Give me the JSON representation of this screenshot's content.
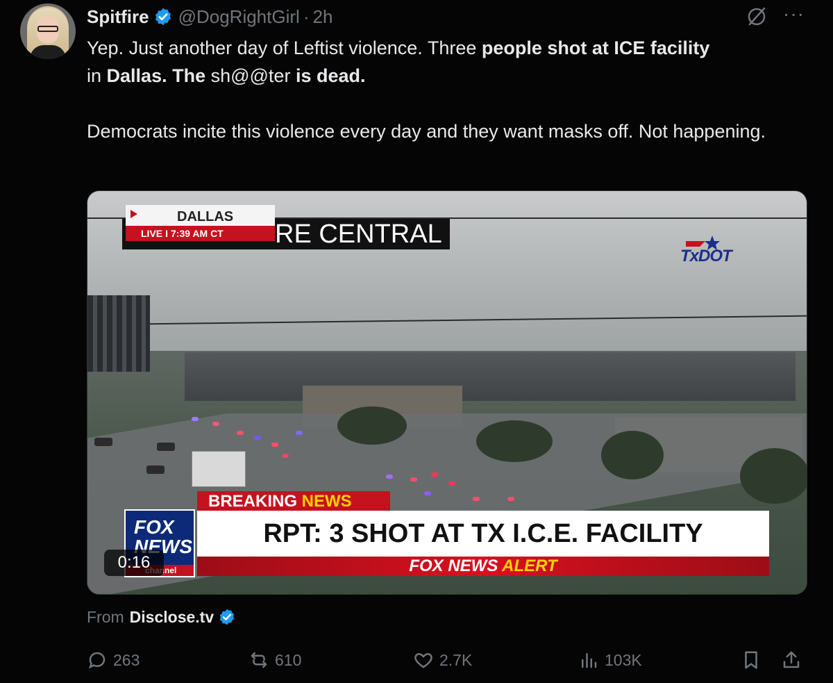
{
  "tweet": {
    "author_name": "Spitfire",
    "handle": "@DogRightGirl",
    "separator": "·",
    "time": "2h",
    "text_line1_a": "Yep. Just another day of Leftist violence. Three ",
    "text_line1_b": "people shot at ICE facility",
    "text_line2_a": "in ",
    "text_line2_b": "Dallas. The",
    "text_line2_c": " sh@@ter ",
    "text_line2_d": "is dead.",
    "text_para2": "Democrats incite this violence every day and they want masks off. Not happening."
  },
  "video": {
    "location": "DALLAS",
    "live_label": "LIVE",
    "live_sep": "I",
    "live_time": "7:39 AM CT",
    "cam_banner": "RE CENTRAL",
    "txdot_logo": "TxDOT",
    "breaking_a": "BREAKING ",
    "breaking_b": "NEWS",
    "headline": "RPT: 3 SHOT AT TX I.C.E. FACILITY",
    "alert_a": "FOX NEWS ",
    "alert_b": "ALERT",
    "channel_logo_line1": "FOX",
    "channel_logo_line2": "NEWS",
    "channel_logo_line3": "channel",
    "duration": "0:16"
  },
  "source": {
    "from_label": "From",
    "name": "Disclose.tv"
  },
  "actions": {
    "replies": "263",
    "reposts": "610",
    "likes": "2.7K",
    "views": "103K"
  },
  "colors": {
    "background": "#050505",
    "text": "#e7e9ea",
    "muted": "#71767b",
    "verified_blue": "#1d9bf0",
    "fox_red": "#c4121f",
    "fox_yellow": "#ffd200"
  }
}
